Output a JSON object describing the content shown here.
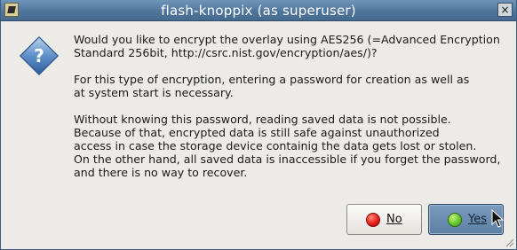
{
  "window": {
    "title": "flash-knoppix (as superuser)",
    "close_glyph": "×"
  },
  "dialog": {
    "icon": "question-icon",
    "paragraphs": [
      "Would you like to encrypt the overlay using AES256 (=Advanced Encryption\nStandard 256bit, http://csrc.nist.gov/encryption/aes/)?",
      "For this type of encryption, entering a password for creation as well as\nat system start is necessary.",
      "Without knowing this password, reading saved data is not possible.\nBecause of that, encrypted data is still safe against unauthorized\naccess in case the storage device containig the data gets lost or stolen.\nOn the other hand, all saved data is inaccessible if you forget the password,\nand there is no way to recover."
    ]
  },
  "buttons": {
    "no_label": "No",
    "yes_label": "Yes",
    "no_icon": "red-circle-icon",
    "yes_icon": "green-circle-icon"
  },
  "colors": {
    "titlebar": "#4f769c",
    "dialog_bg": "#ecebe8",
    "yes_button": "#6586a8"
  }
}
